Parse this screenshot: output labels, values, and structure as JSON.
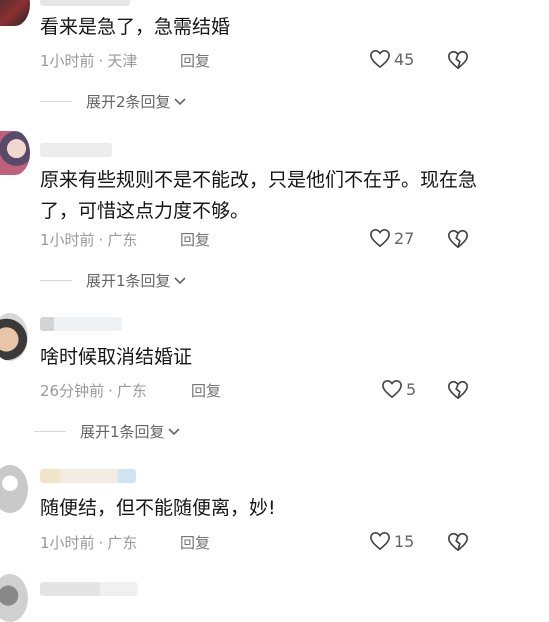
{
  "comments": [
    {
      "text": "看来是急了，急需结婚",
      "time": "1小时前",
      "location": "天津",
      "reply_label": "回复",
      "likes": "45",
      "expand_label": "展开2条回复"
    },
    {
      "text": "原来有些规则不是不能改，只是他们不在乎。现在急了，可惜这点力度不够。",
      "time": "1小时前",
      "location": "广东",
      "reply_label": "回复",
      "likes": "27",
      "expand_label": "展开1条回复"
    },
    {
      "text": "啥时候取消结婚证",
      "time": "26分钟前",
      "location": "广东",
      "reply_label": "回复",
      "likes": "5",
      "expand_label": "展开1条回复"
    },
    {
      "text": "随便结，但不能随便离，妙!",
      "time": "1小时前",
      "location": "广东",
      "reply_label": "回复",
      "likes": "15"
    }
  ],
  "separator": "·",
  "colors": {
    "meta": "#9a9a9a",
    "text": "#161616",
    "icon": "#444444"
  }
}
